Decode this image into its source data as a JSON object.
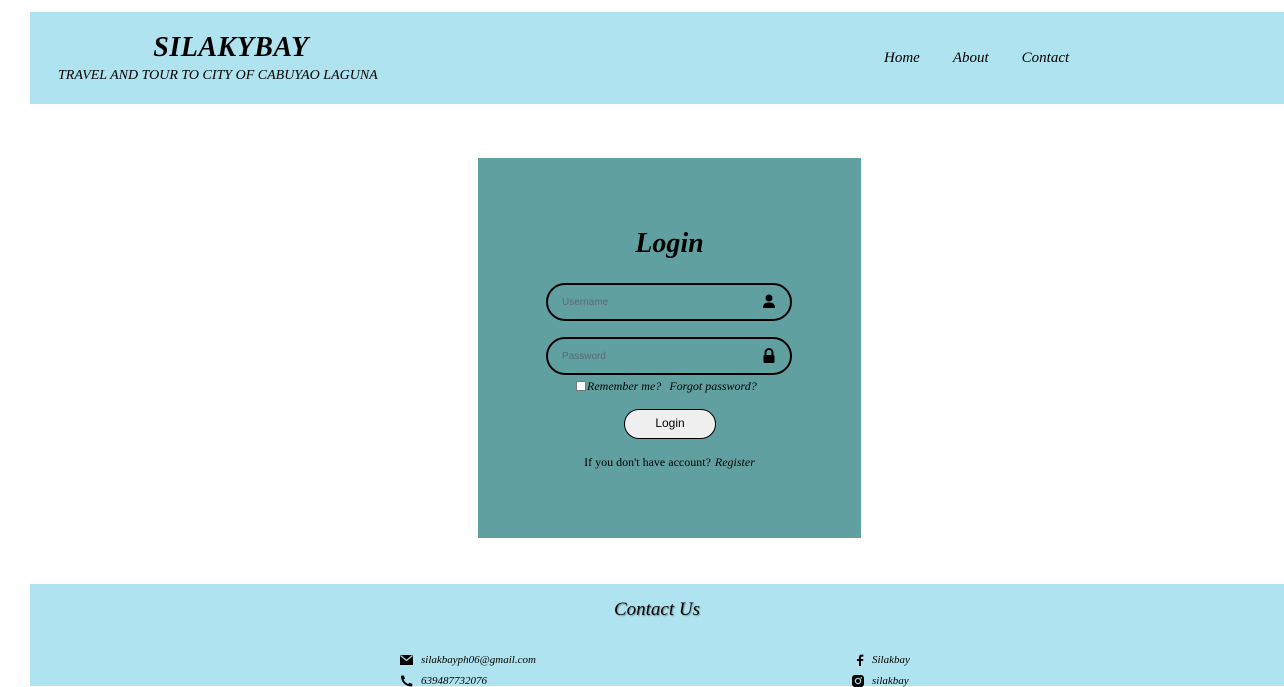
{
  "header": {
    "brand_title": "SILAKYBAY",
    "brand_subtitle": "TRAVEL AND TOUR TO CITY OF CABUYAO LAGUNA",
    "nav": [
      "Home",
      "About",
      "Contact"
    ]
  },
  "login": {
    "title": "Login",
    "username_placeholder": "Username",
    "password_placeholder": "Password",
    "remember_label": "Remember me?",
    "forgot_label": "Forgot password?",
    "button_label": "Login",
    "no_account_text": "If you don't have account?",
    "register_label": "Register"
  },
  "footer": {
    "title": "Contact Us",
    "email": "silakbayph06@gmail.com",
    "phone": "639487732076",
    "facebook": "Silakbay",
    "instagram": "silakbay"
  },
  "icons": {
    "username": "user-icon",
    "password": "lock-icon",
    "email": "envelope-icon",
    "phone": "phone-icon",
    "facebook": "facebook-icon",
    "instagram": "instagram-icon"
  },
  "colors": {
    "header_bg": "#aee3ef",
    "card_bg": "#61a0a0",
    "footer_bg": "#aee3ef"
  }
}
